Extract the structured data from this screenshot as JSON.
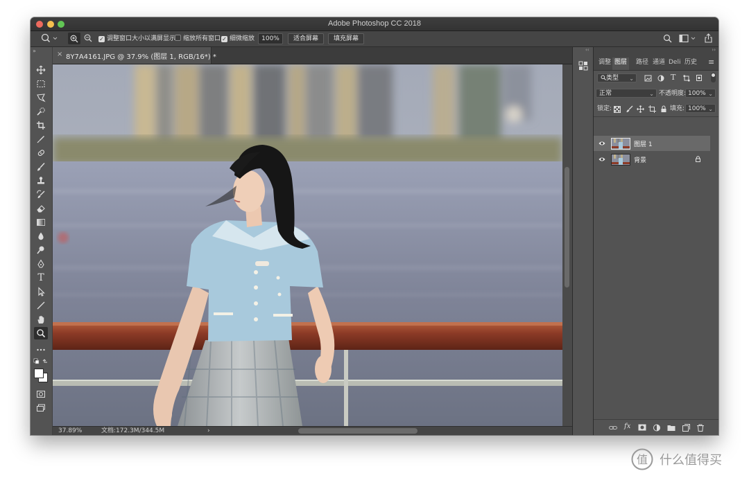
{
  "window": {
    "title": "Adobe Photoshop CC 2018"
  },
  "options_bar": {
    "resize_windows_label": "调整窗口大小以满屏显示",
    "resize_windows_checked": true,
    "zoom_all_label": "缩放所有窗口",
    "zoom_all_checked": false,
    "scrubby_zoom_label": "细微缩放",
    "scrubby_zoom_checked": true,
    "zoom_value": "100%",
    "fit_screen_label": "适合屏幕",
    "fill_screen_label": "填充屏幕"
  },
  "toolbar": {
    "expand_glyph": "»",
    "tools": [
      "move-tool",
      "marquee-tool",
      "lasso-tool",
      "quick-select-tool",
      "crop-tool",
      "eyedropper-tool",
      "spot-healing-tool",
      "brush-tool",
      "clone-stamp-tool",
      "history-brush-tool",
      "eraser-tool",
      "gradient-tool",
      "blur-tool",
      "dodge-tool",
      "pen-tool",
      "type-tool",
      "path-select-tool",
      "line-tool",
      "hand-tool",
      "zoom-tool",
      "more-tools"
    ],
    "selected_tool": "zoom-tool",
    "type_tool_glyph": "T"
  },
  "document": {
    "tab_title": "8Y7A4161.JPG @ 37.9% (图层 1, RGB/16*) *",
    "close_glyph": "×"
  },
  "status": {
    "zoom": "37.89%",
    "doc_size": "文档:172.3M/344.5M",
    "arrow": "›"
  },
  "panels": {
    "collapse_glyph": "‹‹",
    "expand_glyph": "››",
    "tabs": [
      "调整",
      "图层",
      "路径",
      "通道",
      "Deli",
      "历史"
    ],
    "active_tab": "图层",
    "menu_glyph": "≡",
    "filter_type": "类型",
    "blend_mode": "正常",
    "opacity_label": "不透明度:",
    "opacity_value": "100%",
    "lock_label": "锁定:",
    "fill_label": "填充:",
    "fill_value": "100%",
    "layers": [
      {
        "name": "图层 1",
        "visible": true,
        "selected": true,
        "locked": false
      },
      {
        "name": "背景",
        "visible": true,
        "selected": false,
        "locked": true
      }
    ],
    "bottom_icons": [
      "link-icon",
      "fx-icon",
      "mask-icon",
      "adjustment-icon",
      "group-folder-icon",
      "new-layer-icon",
      "trash-icon"
    ],
    "fx_glyph": "fx"
  },
  "watermark": {
    "logo_glyph": "值",
    "text": "什么值得买"
  },
  "colors": {
    "app_bg": "#535353",
    "panel_dark": "#454545",
    "selected_layer": "#696969",
    "red_railing": "#8c3a26",
    "watermark": "#9a9a9a"
  }
}
